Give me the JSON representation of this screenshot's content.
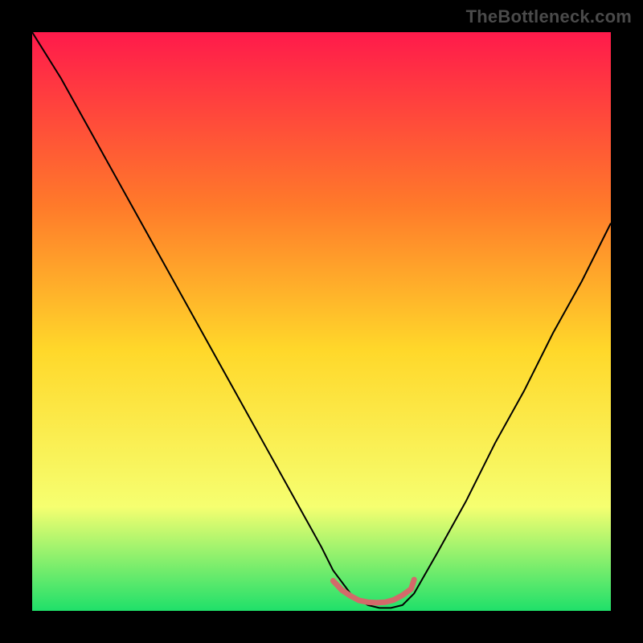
{
  "watermark": {
    "text": "TheBottleneck.com"
  },
  "chart_data": {
    "type": "line",
    "title": "",
    "xlabel": "",
    "ylabel": "",
    "xlim": [
      0,
      100
    ],
    "ylim": [
      0,
      100
    ],
    "colors": {
      "gradient_top": "#ff1a4b",
      "gradient_mid_upper": "#ff7a2a",
      "gradient_mid": "#ffd82a",
      "gradient_lower": "#f6ff70",
      "gradient_bottom": "#1fe06a",
      "frame": "#000000",
      "curve": "#000000",
      "band_stroke": "#d36a6a"
    },
    "series": [
      {
        "name": "bottleneck_curve",
        "x": [
          0,
          5,
          10,
          15,
          20,
          25,
          30,
          35,
          40,
          45,
          50,
          52,
          55,
          58,
          60,
          62,
          64,
          66,
          70,
          75,
          80,
          85,
          90,
          95,
          100
        ],
        "y": [
          100,
          92,
          83,
          74,
          65,
          56,
          47,
          38,
          29,
          20,
          11,
          7,
          3,
          1,
          0.5,
          0.5,
          1,
          3,
          10,
          19,
          29,
          38,
          48,
          57,
          67
        ]
      }
    ],
    "good_band": {
      "x_start": 52,
      "x_end": 66,
      "y_offset": 0.6,
      "segments_x": [
        52,
        53.5,
        55,
        56.5,
        58,
        59.5,
        61,
        62.5,
        64,
        65.5,
        66
      ],
      "segments_y": [
        4.6,
        3.0,
        2.0,
        1.2,
        0.9,
        0.8,
        0.9,
        1.3,
        2.1,
        3.2,
        4.8
      ]
    }
  }
}
